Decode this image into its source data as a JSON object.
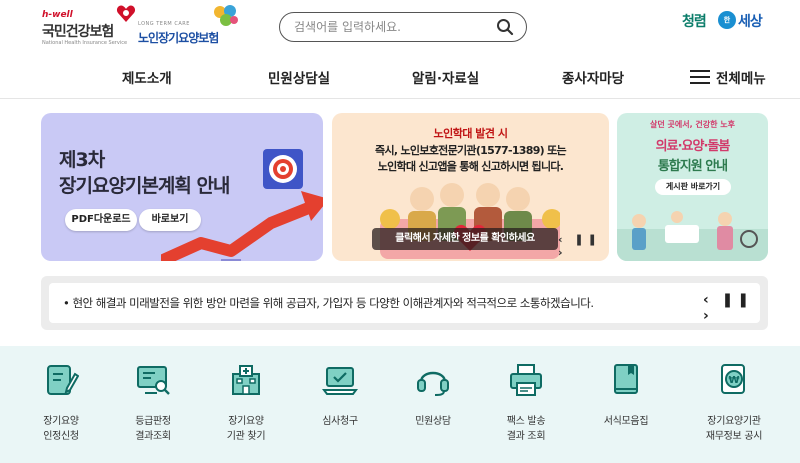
{
  "header": {
    "logo_nhis": {
      "hwell": "h-well",
      "name": "국민건강보험",
      "sub": "National Health Insurance Service"
    },
    "logo_ltc": {
      "eng": "LONG TERM CARE",
      "name": "노인장기요양보험"
    },
    "search": {
      "placeholder": "검색어를 입력하세요."
    },
    "slogan": {
      "left": "청렴",
      "mid": "한",
      "right": "세상"
    }
  },
  "nav": {
    "items": [
      "제도소개",
      "민원상담실",
      "알림·자료실",
      "종사자마당"
    ],
    "all_menu": "전체메뉴"
  },
  "banners": {
    "plan": {
      "line1": "제3차",
      "line2": "장기요양기본계획 안내",
      "pdf_button": "PDF다운로드",
      "view_button": "바로보기"
    },
    "abuse": {
      "line1": "노인학대 발견 시",
      "line2": "즉시, 노인보호전문기관(1577-1389) 또는",
      "line3": "노인학대 신고앱을 통해 신고하시면 됩니다.",
      "caption": "클릭해서 자세한 정보를 확인하세요",
      "controls": "‹ ❚❚ ›"
    },
    "care": {
      "small": "살던 곳에서, 건강한 노후",
      "line1": "의료·요양·돌봄",
      "line2": "통합지원 안내",
      "button": "게시판 바로가기"
    }
  },
  "notice": {
    "text": "•  현안 해결과 미래발전을 위한 방안 마련을 위해 공급자, 가입자 등 다양한 이해관계자와 적극적으로 소통하겠습니다.",
    "controls": "‹ ❚❚ ›"
  },
  "quick_menu": [
    {
      "label": "장기요양\n인정신청",
      "icon": "form-pen-icon"
    },
    {
      "label": "등급판정\n결과조회",
      "icon": "monitor-search-icon"
    },
    {
      "label": "장기요양\n기관 찾기",
      "icon": "hospital-building-icon"
    },
    {
      "label": "심사청구",
      "icon": "laptop-check-icon"
    },
    {
      "label": "민원상담",
      "icon": "headset-icon"
    },
    {
      "label": "팩스 발송\n결과 조회",
      "icon": "fax-printer-icon"
    },
    {
      "label": "서식모음집",
      "icon": "book-icon"
    },
    {
      "label": "장기요양기관\n재무정보 공시",
      "icon": "won-document-icon"
    }
  ],
  "colors": {
    "teal": "#12857a",
    "banner_purple": "#c9c9f5",
    "banner_peach": "#fce6cf",
    "banner_mint": "#cfeee4",
    "quick_bg": "#eaf6f6"
  }
}
